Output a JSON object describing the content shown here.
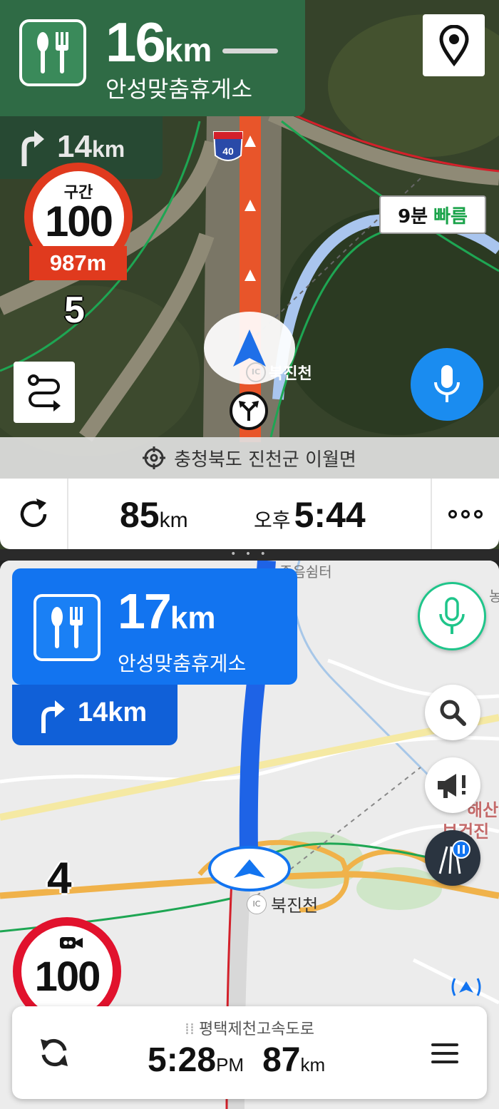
{
  "top_panel": {
    "poi": {
      "distance_value": "16",
      "distance_unit": "km",
      "name": "안성맞춤휴게소",
      "icon": "restaurant-icon"
    },
    "next_turn": {
      "distance_value": "14",
      "distance_unit": "km",
      "icon": "turn-right-arrow-icon"
    },
    "section_speed": {
      "label": "구간",
      "limit": "100",
      "remaining": "987m"
    },
    "lanes": "5",
    "route_badge": "40",
    "faster_route": {
      "minutes": "9분",
      "label": "빠름"
    },
    "interchange": {
      "badge": "IC",
      "name": "북진천"
    },
    "address": "충청북도 진천군 이월면",
    "status": {
      "remaining_value": "85",
      "remaining_unit": "km",
      "ampm": "오후",
      "arrival_time": "5:44"
    },
    "colors": {
      "banner": "#2f6b45",
      "accent": "#1a8cf0",
      "alert": "#e03a1e",
      "fast": "#1aa34a"
    }
  },
  "bottom_panel": {
    "place_labels": {
      "rest_area": "졸음쉼터",
      "health_center_1": "해산",
      "health_center_2": "보건진료",
      "edge": "농"
    },
    "poi": {
      "distance_value": "17",
      "distance_unit": "km",
      "name": "안성맞춤휴게소",
      "icon": "restaurant-icon"
    },
    "next_turn": {
      "distance": "14km",
      "icon": "turn-right-arrow-icon"
    },
    "lanes": "4",
    "speed_camera": {
      "limit": "100",
      "icon": "camera-icon"
    },
    "interchange": {
      "badge": "IC",
      "name": "북진천"
    },
    "status": {
      "road_name": "평택제천고속도로",
      "arrival_time": "5:28",
      "ampm": "PM",
      "remaining_value": "87",
      "remaining_unit": "km"
    },
    "colors": {
      "card": "#1274f0",
      "route": "#1e63e6",
      "mic": "#1fc58a",
      "camera": "#e1122d"
    }
  }
}
